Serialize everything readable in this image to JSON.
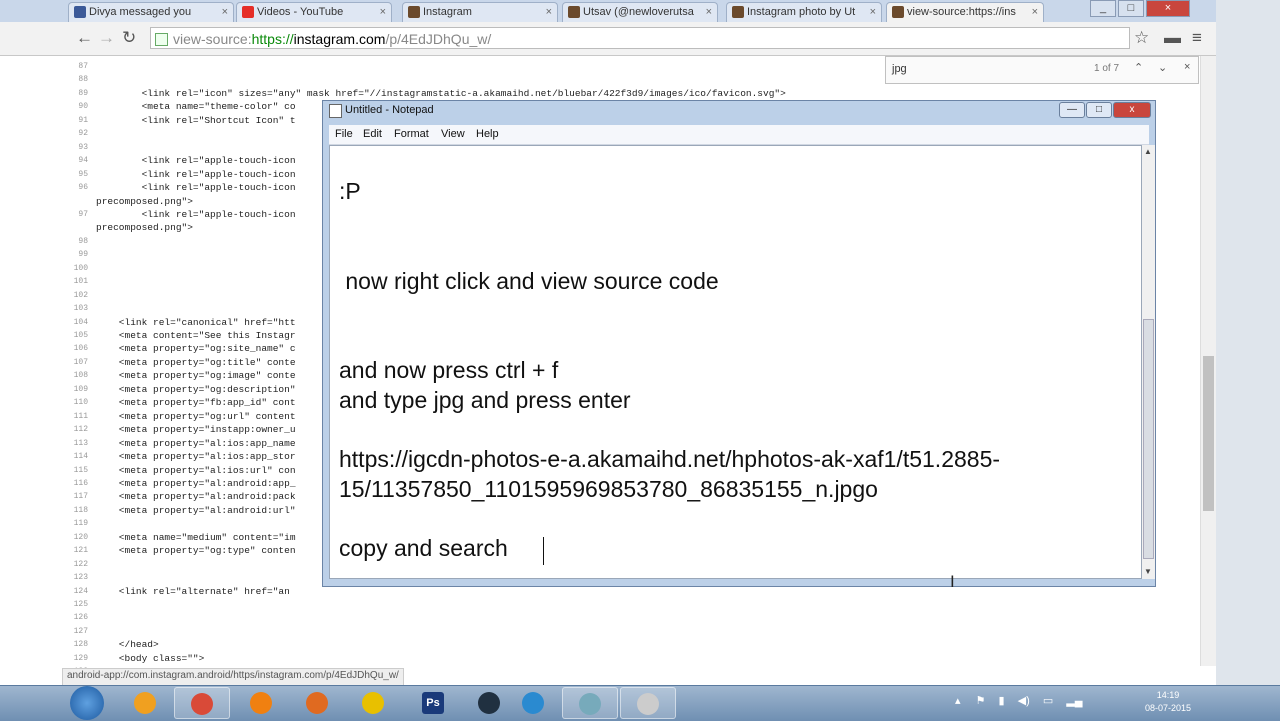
{
  "tabs": [
    {
      "label": "Divya messaged you",
      "icon": "facebook-icon",
      "color": "#3b5998"
    },
    {
      "label": "Videos - YouTube",
      "icon": "youtube-icon",
      "color": "#e52d27"
    },
    {
      "label": "Instagram",
      "icon": "instagram-icon",
      "color": "#6b4a2c"
    },
    {
      "label": "Utsav (@newloverutsa",
      "icon": "instagram-icon",
      "color": "#6b4a2c"
    },
    {
      "label": "Instagram photo by Ut",
      "icon": "instagram-icon",
      "color": "#6b4a2c"
    },
    {
      "label": "view-source:https://ins",
      "icon": "instagram-icon",
      "color": "#6b4a2c"
    }
  ],
  "tab_close": "×",
  "window_controls": {
    "minimize": "_",
    "maximize": "□",
    "close": "×"
  },
  "toolbar": {
    "back": "←",
    "forward": "→",
    "reload": "↻",
    "url_prefix": "view-source:",
    "url_scheme": "https://",
    "url_host": "instagram.com",
    "url_path": "/p/4EdJDhQu_w/",
    "star": "☆",
    "menu": "≡"
  },
  "findbar": {
    "query": "jpg",
    "count": "1 of 7",
    "up": "⌃",
    "down": "⌄",
    "close": "×"
  },
  "source_lines": [
    {
      "n": "87",
      "code": ""
    },
    {
      "n": "88",
      "code": ""
    },
    {
      "n": "89",
      "code": "        <link rel=\"icon\" sizes=\"any\" mask href=\"//instagramstatic-a.akamaihd.net/bluebar/422f3d9/images/ico/favicon.svg\">"
    },
    {
      "n": "90",
      "code": "        <meta name=\"theme-color\" co"
    },
    {
      "n": "91",
      "code": "        <link rel=\"Shortcut Icon\" t"
    },
    {
      "n": "92",
      "code": ""
    },
    {
      "n": "93",
      "code": ""
    },
    {
      "n": "94",
      "code": "        <link rel=\"apple-touch-icon"
    },
    {
      "n": "95",
      "code": "        <link rel=\"apple-touch-icon"
    },
    {
      "n": "96",
      "code": "        <link rel=\"apple-touch-icon"
    },
    {
      "n": "",
      "code": "precomposed.png\">"
    },
    {
      "n": "97",
      "code": "        <link rel=\"apple-touch-icon"
    },
    {
      "n": "",
      "code": "precomposed.png\">"
    },
    {
      "n": "98",
      "code": ""
    },
    {
      "n": "99",
      "code": ""
    },
    {
      "n": "100",
      "code": ""
    },
    {
      "n": "101",
      "code": ""
    },
    {
      "n": "102",
      "code": ""
    },
    {
      "n": "103",
      "code": ""
    },
    {
      "n": "104",
      "code": "    <link rel=\"canonical\" href=\"htt"
    },
    {
      "n": "105",
      "code": "    <meta content=\"See this Instagr"
    },
    {
      "n": "106",
      "code": "    <meta property=\"og:site_name\" c"
    },
    {
      "n": "107",
      "code": "    <meta property=\"og:title\" conte"
    },
    {
      "n": "108",
      "code": "    <meta property=\"og:image\" conte"
    },
    {
      "n": "109",
      "code": "    <meta property=\"og:description\""
    },
    {
      "n": "110",
      "code": "    <meta property=\"fb:app_id\" cont"
    },
    {
      "n": "111",
      "code": "    <meta property=\"og:url\" content"
    },
    {
      "n": "112",
      "code": "    <meta property=\"instapp:owner_u"
    },
    {
      "n": "113",
      "code": "    <meta property=\"al:ios:app_name"
    },
    {
      "n": "114",
      "code": "    <meta property=\"al:ios:app_stor"
    },
    {
      "n": "115",
      "code": "    <meta property=\"al:ios:url\" con"
    },
    {
      "n": "116",
      "code": "    <meta property=\"al:android:app_"
    },
    {
      "n": "117",
      "code": "    <meta property=\"al:android:pack"
    },
    {
      "n": "118",
      "code": "    <meta property=\"al:android:url\""
    },
    {
      "n": "119",
      "code": ""
    },
    {
      "n": "120",
      "code": "    <meta name=\"medium\" content=\"im"
    },
    {
      "n": "121",
      "code": "    <meta property=\"og:type\" conten"
    },
    {
      "n": "122",
      "code": ""
    },
    {
      "n": "123",
      "code": ""
    },
    {
      "n": "124",
      "code": "    <link rel=\"alternate\" href=\"an"
    },
    {
      "n": "125",
      "code": ""
    },
    {
      "n": "126",
      "code": ""
    },
    {
      "n": "127",
      "code": ""
    },
    {
      "n": "128",
      "code": "    </head>"
    },
    {
      "n": "129",
      "code": "    <body class=\"\">"
    },
    {
      "n": "130",
      "code": ""
    }
  ],
  "status_text": "android-app://com.instagram.android/https/instagram.com/p/4EdJDhQu_w/",
  "notepad": {
    "title": "Untitled - Notepad",
    "menu": [
      "File",
      "Edit",
      "Format",
      "View",
      "Help"
    ],
    "lines": [
      ":P",
      " now right click and view source code",
      "and now press ctrl + f",
      "and type jpg and press enter",
      "https://igcdn-photos-e-a.akamaihd.net/hphotos-ak-xaf1/t51.2885-",
      "15/11357850_1101595969853780_86835155_n.jpgo",
      "copy and search "
    ],
    "wc": {
      "minimize": "—",
      "maximize": "□",
      "close": "x"
    }
  },
  "taskbar": {
    "apps": [
      {
        "name": "media-player-icon",
        "label": "",
        "color": "#f0a020"
      },
      {
        "name": "chrome-icon",
        "label": "",
        "color": "#d94a38"
      },
      {
        "name": "vlc-icon",
        "label": "",
        "color": "#f08010"
      },
      {
        "name": "firefox-icon",
        "label": "",
        "color": "#e06a20"
      },
      {
        "name": "norton-icon",
        "label": "",
        "color": "#e8c000"
      },
      {
        "name": "photoshop-icon",
        "label": "Ps",
        "color": "#1a3a7a"
      },
      {
        "name": "app-icon",
        "label": "",
        "color": "#203040"
      },
      {
        "name": "ie-icon",
        "label": "",
        "color": "#2a8ad0"
      },
      {
        "name": "notepad-icon",
        "label": "",
        "color": "#7ab"
      },
      {
        "name": "window-icon",
        "label": "",
        "color": "#ccc"
      }
    ],
    "time": "14:19",
    "date": "08-07-2015"
  },
  "colors": {
    "accent": "#1a1aa6",
    "chrome_bg": "#f2f2f2",
    "notepad_frame": "#bcd0e8"
  }
}
